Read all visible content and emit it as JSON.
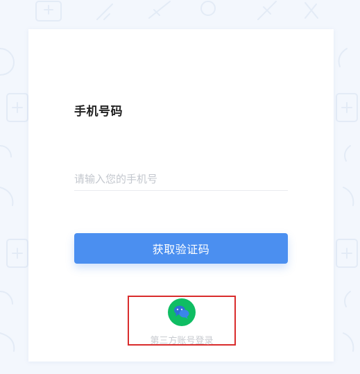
{
  "login": {
    "phone_label": "手机号码",
    "phone_placeholder": "请输入您的手机号",
    "phone_value": "",
    "get_code_label": "获取验证码",
    "third_party_label": "第三方账号登录"
  },
  "icons": {
    "third_party": "wechat-icon"
  },
  "colors": {
    "primary": "#4b8ff0",
    "wechat": "#0fbd63",
    "highlight_box": "#d92b2b",
    "background": "#f3f7fd"
  }
}
